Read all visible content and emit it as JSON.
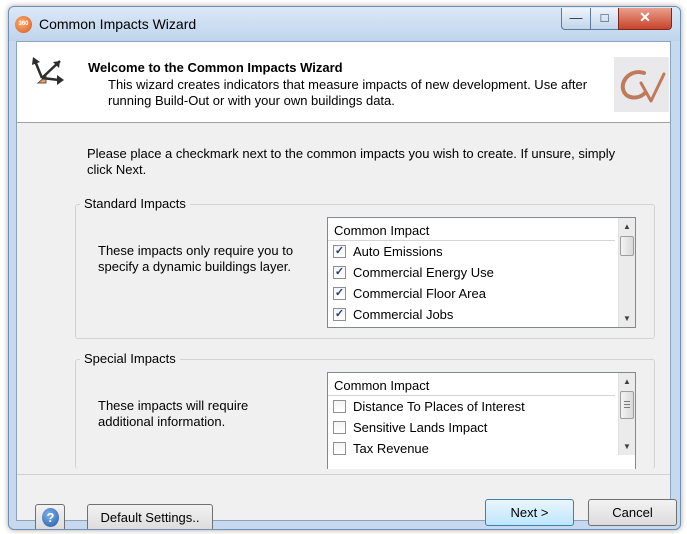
{
  "window": {
    "title": "Common Impacts Wizard",
    "app_icon_text": "360"
  },
  "header": {
    "title": "Welcome to the Common Impacts Wizard",
    "description": "This wizard creates indicators that measure impacts of new development.  Use after running Build-Out or with your own buildings data."
  },
  "intro": "Please place a checkmark next to the common impacts you wish to create.  If unsure, simply click Next.",
  "standard": {
    "title": "Standard Impacts",
    "description": "These impacts only require you to specify a dynamic buildings layer.",
    "column_header": "Common Impact",
    "items": [
      {
        "label": "Auto Emissions",
        "checked": true
      },
      {
        "label": "Commercial Energy Use",
        "checked": true
      },
      {
        "label": "Commercial Floor Area",
        "checked": true
      },
      {
        "label": "Commercial Jobs",
        "checked": true
      }
    ]
  },
  "special": {
    "title": "Special Impacts",
    "description": "These impacts will require additional information.",
    "column_header": "Common Impact",
    "items": [
      {
        "label": "Distance To Places of Interest",
        "checked": false
      },
      {
        "label": "Sensitive Lands Impact",
        "checked": false
      },
      {
        "label": "Tax Revenue",
        "checked": false
      }
    ]
  },
  "footer": {
    "default_settings_label": "Default Settings..",
    "next_label": "Next >",
    "cancel_label": "Cancel"
  },
  "icons": {
    "app": "app-icon",
    "wizard": "wizard-arrows-icon",
    "logo": "cv-logo",
    "help": "help-question-icon"
  },
  "colors": {
    "title_bar": "#c6d9ee",
    "close_button": "#c8432a",
    "primary_button": "#bee6fd",
    "checkmark": "#1f3f7a"
  }
}
